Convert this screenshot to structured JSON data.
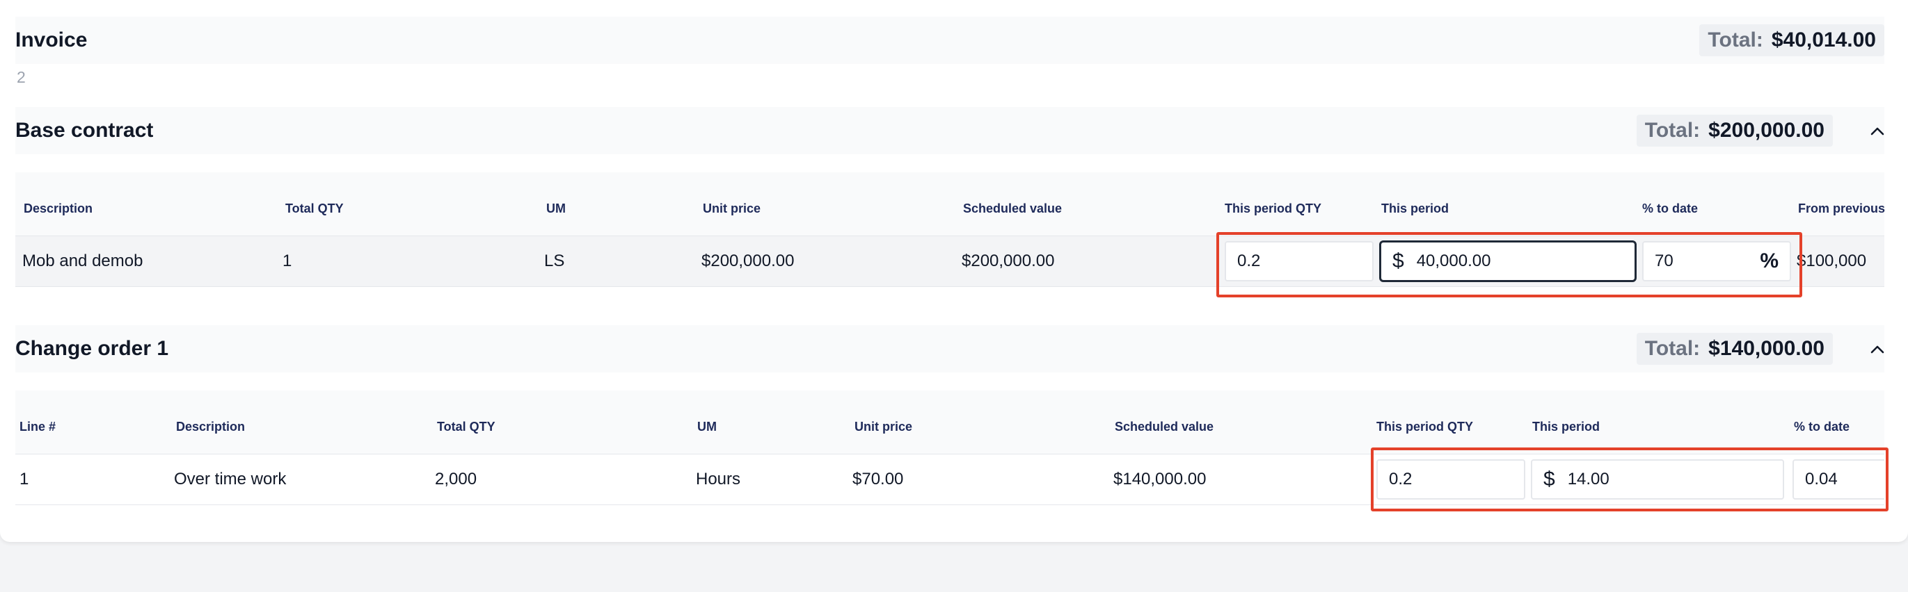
{
  "invoice": {
    "title": "Invoice",
    "number": "2",
    "total_label": "Total:",
    "total_value": "$40,014.00"
  },
  "base_contract": {
    "title": "Base contract",
    "total_label": "Total:",
    "total_value": "$200,000.00",
    "columns": [
      "Description",
      "Total QTY",
      "UM",
      "Unit price",
      "Scheduled value",
      "This period QTY",
      "This period",
      "% to date",
      "From previous"
    ],
    "row": {
      "description": "Mob and demob",
      "total_qty": "1",
      "um": "LS",
      "unit_price": "$200,000.00",
      "scheduled_value": "$200,000.00",
      "this_period_qty": "0.2",
      "this_period_prefix": "$",
      "this_period": "40,000.00",
      "percent_to_date": "70",
      "percent_suffix": "%",
      "from_previous": "$100,000"
    }
  },
  "change_order": {
    "title": "Change order 1",
    "total_label": "Total:",
    "total_value": "$140,000.00",
    "columns": [
      "Line #",
      "Description",
      "Total QTY",
      "UM",
      "Unit price",
      "Scheduled value",
      "This period QTY",
      "This period",
      "% to date"
    ],
    "row": {
      "line": "1",
      "description": "Over time work",
      "total_qty": "2,000",
      "um": "Hours",
      "unit_price": "$70.00",
      "scheduled_value": "$140,000.00",
      "this_period_qty": "0.2",
      "this_period_prefix": "$",
      "this_period": "14.00",
      "percent_to_date": "0.04"
    }
  },
  "colors": {
    "highlight": "#e4412a",
    "header_text": "#1e2a5a"
  }
}
